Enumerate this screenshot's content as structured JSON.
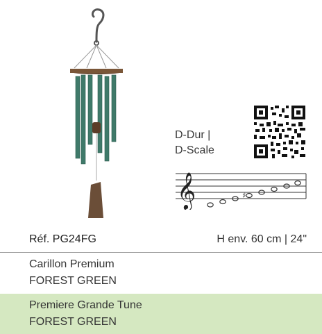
{
  "scale": {
    "line1": "D-Dur |",
    "line2": "D-Scale"
  },
  "product": {
    "ref": "Réf. PG24FG",
    "dimensions": "H env. 60 cm | 24\""
  },
  "names": [
    {
      "title": "Carillon Premium",
      "color": "FOREST GREEN"
    },
    {
      "title": "Premiere Grande Tune",
      "color": "FOREST GREEN"
    }
  ],
  "colors": {
    "highlight_bg": "#d5e8c1",
    "tube": "#3f7a6a",
    "wood": "#6a4a33"
  }
}
